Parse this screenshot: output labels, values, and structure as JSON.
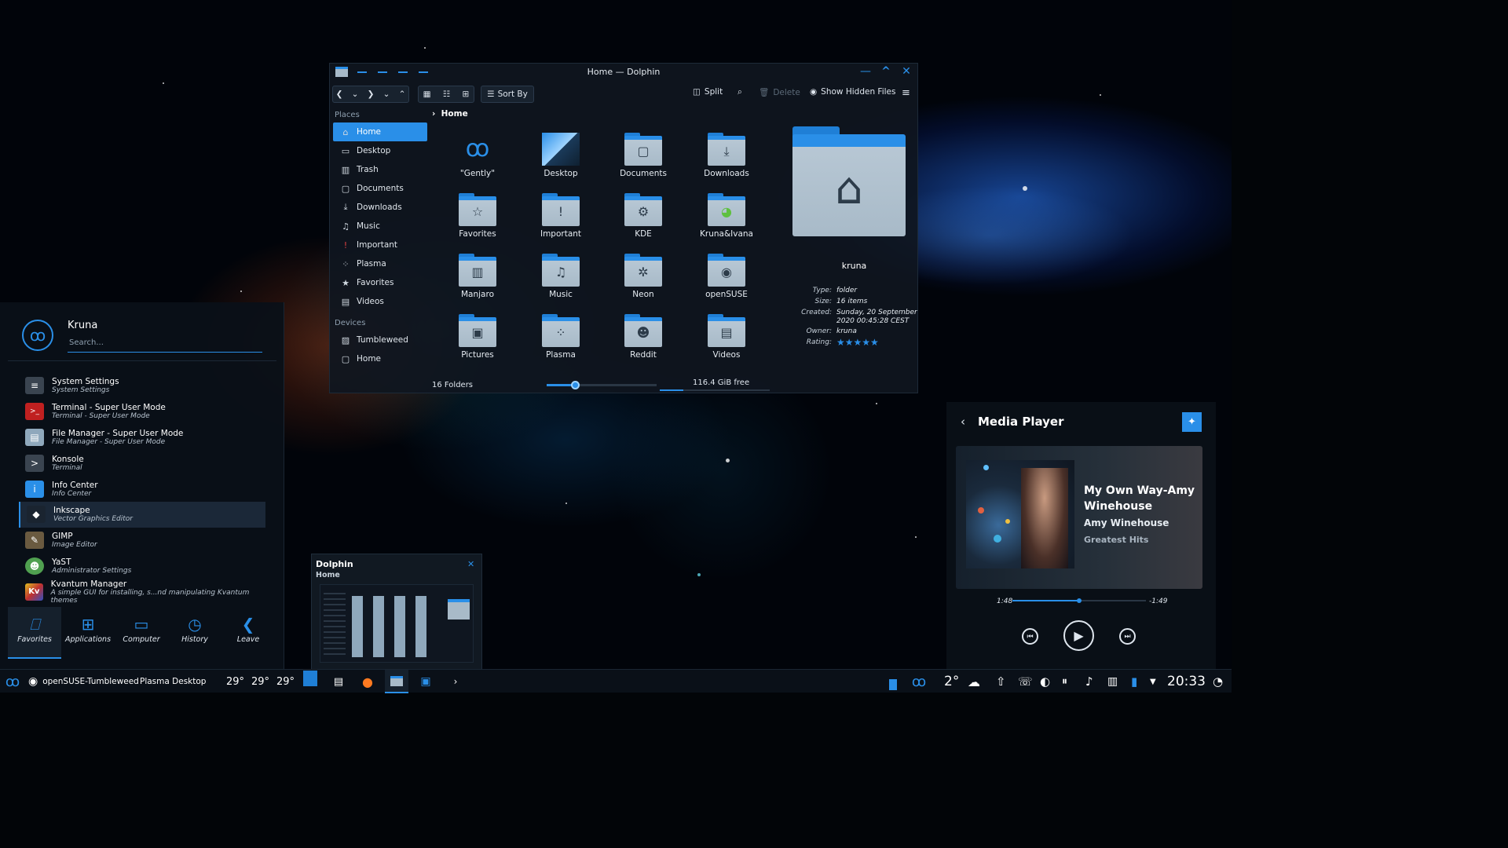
{
  "dolphin": {
    "title": "Home — Dolphin",
    "toolbar": {
      "sort_by": "Sort By",
      "split": "Split",
      "delete": "Delete",
      "show_hidden": "Show Hidden Files"
    },
    "places_header": "Places",
    "places": [
      "Home",
      "Desktop",
      "Trash",
      "Documents",
      "Downloads",
      "Music",
      "Important",
      "Plasma",
      "Favorites",
      "Videos"
    ],
    "devices_header": "Devices",
    "devices": [
      "Tumbleweed",
      "Home"
    ],
    "breadcrumb": "Home",
    "folders": [
      "\"Gently\"",
      "Desktop",
      "Documents",
      "Downloads",
      "Favorites",
      "Important",
      "KDE",
      "Kruna&Ivana",
      "Manjaro",
      "Music",
      "Neon",
      "openSUSE",
      "Pictures",
      "Plasma",
      "Reddit",
      "Videos"
    ],
    "info": {
      "name": "kruna",
      "type_label": "Type:",
      "type": "folder",
      "size_label": "Size:",
      "size": "16 items",
      "created_label": "Created:",
      "created_1": "Sunday, 20 September",
      "created_2": "2020 00:45:28 CEST",
      "owner_label": "Owner:",
      "owner": "kruna",
      "rating_label": "Rating:",
      "rating": "★★★★★"
    },
    "status_count": "16 Folders",
    "status_free": "116.4 GiB free",
    "zoom_fraction": 0.26
  },
  "kickoff": {
    "user": "Kruna",
    "search_placeholder": "Search...",
    "apps": [
      {
        "name": "System Settings",
        "sub": "System Settings",
        "icon": "≡"
      },
      {
        "name": "Terminal - Super User Mode",
        "sub": "Terminal - Super User Mode",
        "icon": ">_"
      },
      {
        "name": "File Manager - Super User Mode",
        "sub": "File Manager - Super User Mode",
        "icon": "▤"
      },
      {
        "name": "Konsole",
        "sub": "Terminal",
        "icon": ">"
      },
      {
        "name": "Info Center",
        "sub": "Info Center",
        "icon": "i"
      },
      {
        "name": "Inkscape",
        "sub": "Vector Graphics Editor",
        "icon": "◆"
      },
      {
        "name": "GIMP",
        "sub": "Image Editor",
        "icon": "✎"
      },
      {
        "name": "YaST",
        "sub": "Administrator Settings",
        "icon": "☻"
      },
      {
        "name": "Kvantum Manager",
        "sub": "A simple GUI for installing, s...nd manipulating Kvantum themes",
        "icon": "Kv"
      }
    ],
    "nav": [
      "Favorites",
      "Applications",
      "Computer",
      "History",
      "Leave"
    ]
  },
  "media": {
    "header": "Media Player",
    "track": "My Own Way-Amy Winehouse",
    "artist": "Amy Winehouse",
    "album": "Greatest Hits",
    "elapsed": "1:48",
    "remaining": "-1:49",
    "progress_fraction": 0.5
  },
  "preview": {
    "app": "Dolphin",
    "sub": "Home"
  },
  "taskbar": {
    "activity": "openSUSE-Tumbleweed",
    "desktop": "Plasma Desktop",
    "temps": [
      "29°",
      "29°",
      "29°"
    ],
    "weather_temp": "2°",
    "clock": "20:33"
  },
  "colors": {
    "accent": "#2a8fe8",
    "panel": "#0a1018"
  }
}
